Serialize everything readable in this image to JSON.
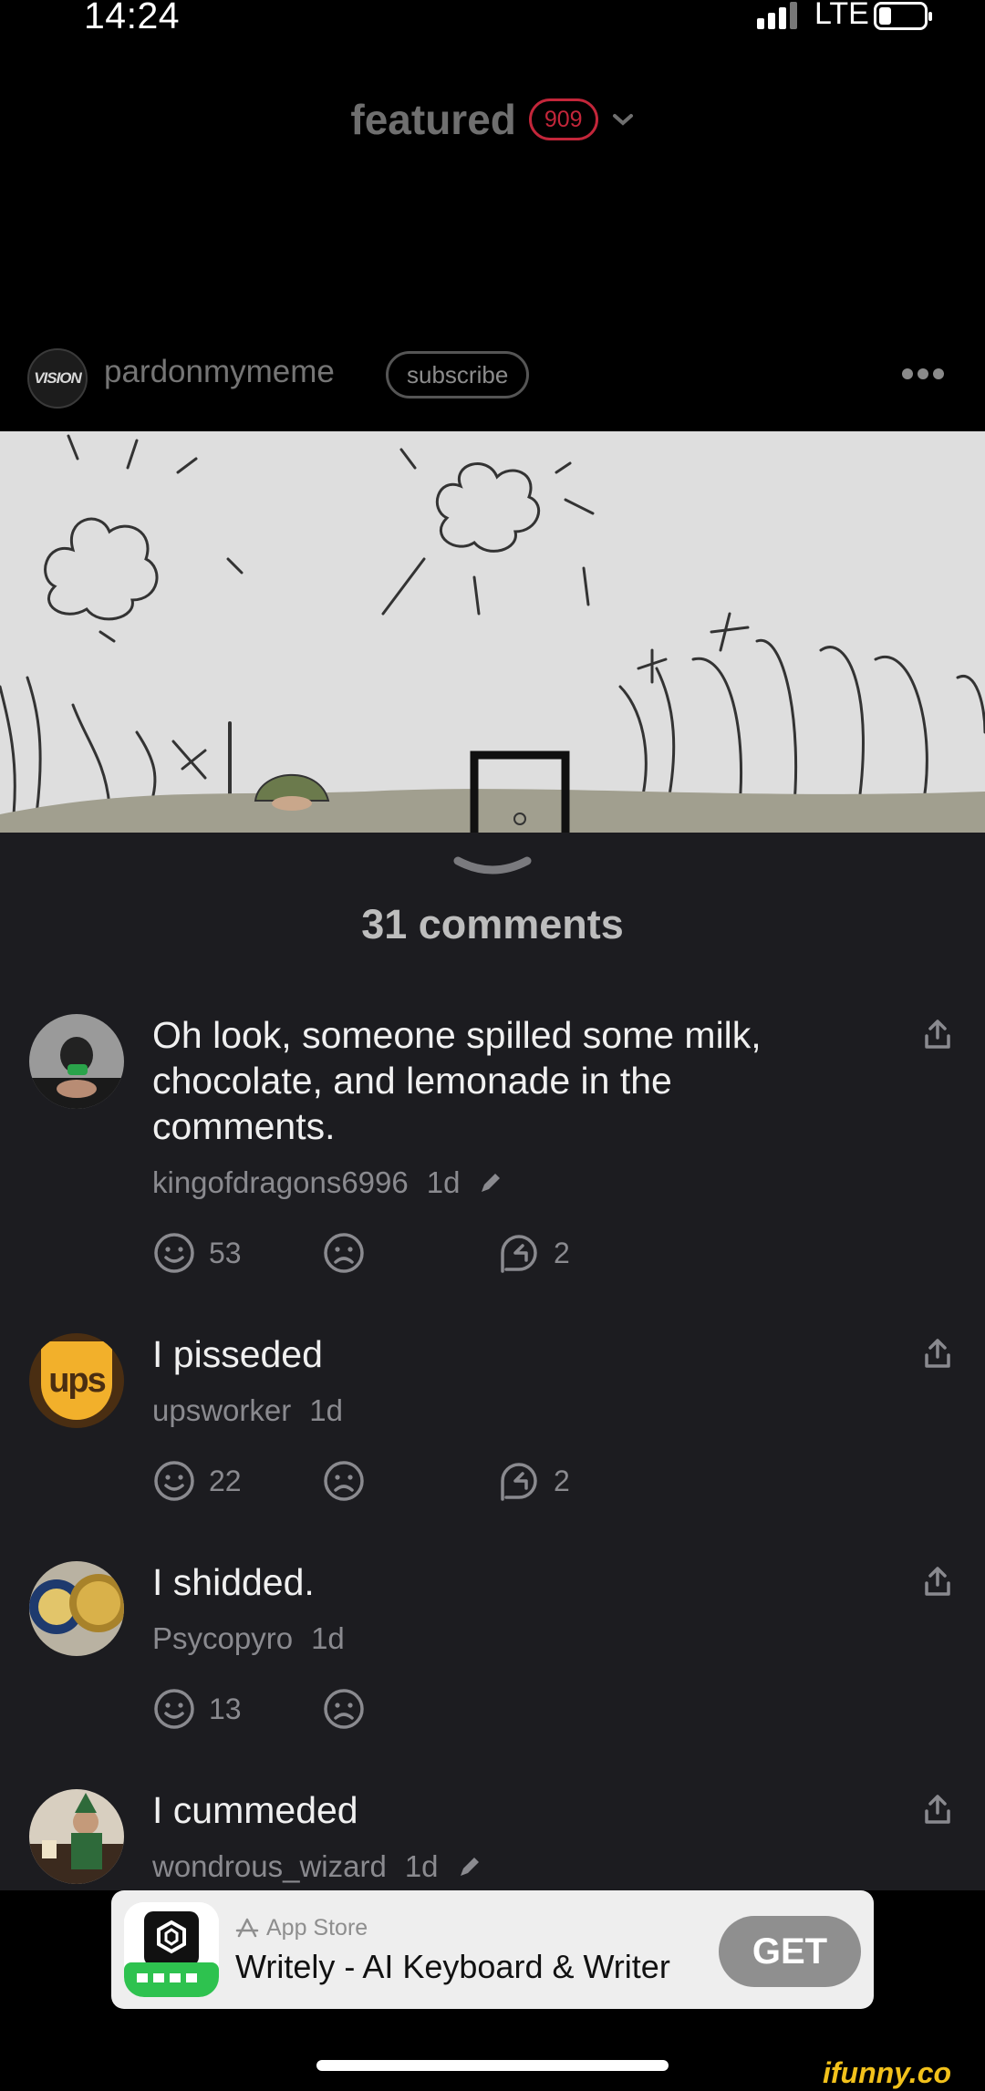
{
  "status_bar": {
    "time": "14:24",
    "network": "LTE"
  },
  "feed": {
    "title": "featured",
    "badge": "909"
  },
  "post": {
    "avatar_text": "VISION",
    "author": "pardonmymeme",
    "subscribe_label": "subscribe"
  },
  "comments_title": "31 comments",
  "comments": [
    {
      "text": "Oh look, someone spilled some milk, chocolate, and lemonade in the comments.",
      "user": "kingofdragons6996",
      "time": "1d",
      "edited": true,
      "smiles": "53",
      "replies": "2"
    },
    {
      "text": "I pisseded",
      "user": "upsworker",
      "time": "1d",
      "edited": false,
      "smiles": "22",
      "replies": "2",
      "avatar_text": "ups"
    },
    {
      "text": "I shidded.",
      "user": "Psycopyro",
      "time": "1d",
      "edited": false,
      "smiles": "13",
      "replies": ""
    },
    {
      "text": "I cummeded",
      "user": "wondrous_wizard",
      "time": "1d",
      "edited": true
    }
  ],
  "ad": {
    "store_label": "App Store",
    "title": "Writely - AI Keyboard & Writer",
    "cta": "GET"
  },
  "watermark": "ifunny.co",
  "colors": {
    "badge": "#c3263a",
    "sheet_bg": "#1c1c20",
    "watermark": "#f2c11b"
  }
}
